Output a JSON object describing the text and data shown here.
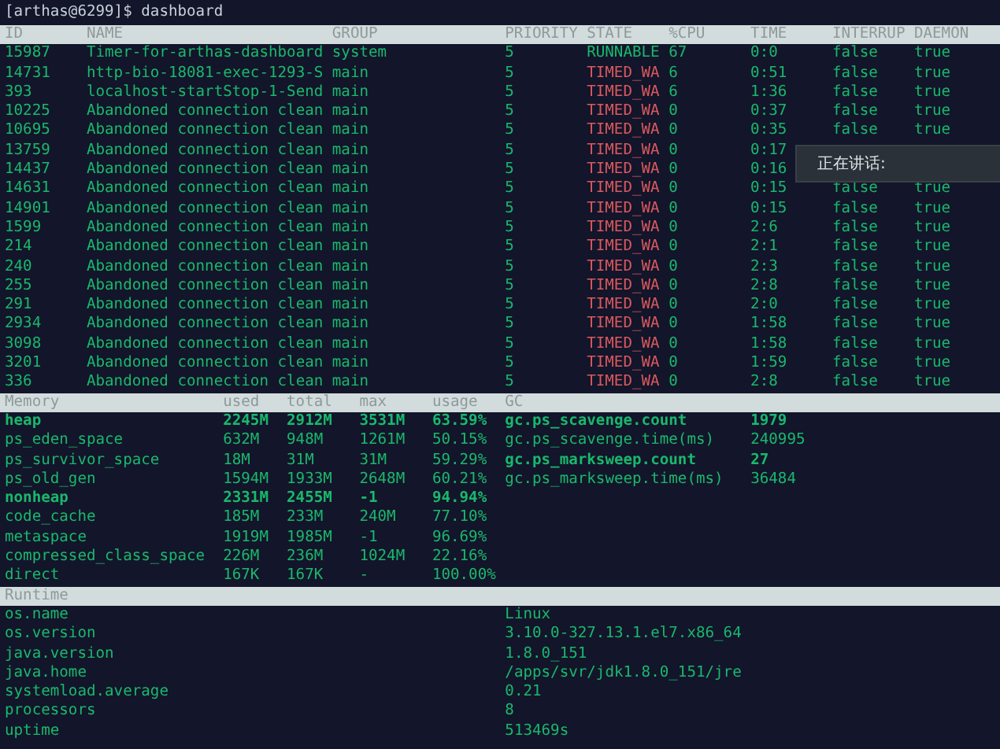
{
  "prompt": {
    "text": "[arthas@6299]$ dashboard"
  },
  "threads": {
    "columns": [
      "ID",
      "NAME",
      "GROUP",
      "PRIORITY",
      "STATE",
      "%CPU",
      "TIME",
      "INTERRUP",
      "DAEMON"
    ],
    "rows": [
      {
        "id": "15987",
        "name": "Timer-for-arthas-dashboard",
        "group": "system",
        "priority": "5",
        "state": "RUNNABLE",
        "color": "#19b86c",
        "cpu": "67",
        "time": "0:0",
        "interrupted": "false",
        "daemon": "true"
      },
      {
        "id": "14731",
        "name": "http-bio-18081-exec-1293-S",
        "group": "main",
        "priority": "5",
        "state": "TIMED_WA",
        "color": "#d9595f",
        "cpu": "6",
        "time": "0:51",
        "interrupted": "false",
        "daemon": "true"
      },
      {
        "id": "393",
        "name": "localhost-startStop-1-Send",
        "group": "main",
        "priority": "5",
        "state": "TIMED_WA",
        "color": "#d9595f",
        "cpu": "6",
        "time": "1:36",
        "interrupted": "false",
        "daemon": "true"
      },
      {
        "id": "10225",
        "name": "Abandoned connection clean",
        "group": "main",
        "priority": "5",
        "state": "TIMED_WA",
        "color": "#d9595f",
        "cpu": "0",
        "time": "0:37",
        "interrupted": "false",
        "daemon": "true"
      },
      {
        "id": "10695",
        "name": "Abandoned connection clean",
        "group": "main",
        "priority": "5",
        "state": "TIMED_WA",
        "color": "#d9595f",
        "cpu": "0",
        "time": "0:35",
        "interrupted": "false",
        "daemon": "true"
      },
      {
        "id": "13759",
        "name": "Abandoned connection clean",
        "group": "main",
        "priority": "5",
        "state": "TIMED_WA",
        "color": "#d9595f",
        "cpu": "0",
        "time": "0:17"
      },
      {
        "id": "14437",
        "name": "Abandoned connection clean",
        "group": "main",
        "priority": "5",
        "state": "TIMED_WA",
        "color": "#d9595f",
        "cpu": "0",
        "time": "0:16"
      },
      {
        "id": "14631",
        "name": "Abandoned connection clean",
        "group": "main",
        "priority": "5",
        "state": "TIMED_WA",
        "color": "#d9595f",
        "cpu": "0",
        "time": "0:15",
        "interrupted": "false",
        "daemon": "true"
      },
      {
        "id": "14901",
        "name": "Abandoned connection clean",
        "group": "main",
        "priority": "5",
        "state": "TIMED_WA",
        "color": "#d9595f",
        "cpu": "0",
        "time": "0:15",
        "interrupted": "false",
        "daemon": "true"
      },
      {
        "id": "1599",
        "name": "Abandoned connection clean",
        "group": "main",
        "priority": "5",
        "state": "TIMED_WA",
        "color": "#d9595f",
        "cpu": "0",
        "time": "2:6",
        "interrupted": "false",
        "daemon": "true"
      },
      {
        "id": "214",
        "name": "Abandoned connection clean",
        "group": "main",
        "priority": "5",
        "state": "TIMED_WA",
        "color": "#d9595f",
        "cpu": "0",
        "time": "2:1",
        "interrupted": "false",
        "daemon": "true"
      },
      {
        "id": "240",
        "name": "Abandoned connection clean",
        "group": "main",
        "priority": "5",
        "state": "TIMED_WA",
        "color": "#d9595f",
        "cpu": "0",
        "time": "2:3",
        "interrupted": "false",
        "daemon": "true"
      },
      {
        "id": "255",
        "name": "Abandoned connection clean",
        "group": "main",
        "priority": "5",
        "state": "TIMED_WA",
        "color": "#d9595f",
        "cpu": "0",
        "time": "2:8",
        "interrupted": "false",
        "daemon": "true"
      },
      {
        "id": "291",
        "name": "Abandoned connection clean",
        "group": "main",
        "priority": "5",
        "state": "TIMED_WA",
        "color": "#d9595f",
        "cpu": "0",
        "time": "2:0",
        "interrupted": "false",
        "daemon": "true"
      },
      {
        "id": "2934",
        "name": "Abandoned connection clean",
        "group": "main",
        "priority": "5",
        "state": "TIMED_WA",
        "color": "#d9595f",
        "cpu": "0",
        "time": "1:58",
        "interrupted": "false",
        "daemon": "true"
      },
      {
        "id": "3098",
        "name": "Abandoned connection clean",
        "group": "main",
        "priority": "5",
        "state": "TIMED_WA",
        "color": "#d9595f",
        "cpu": "0",
        "time": "1:58",
        "interrupted": "false",
        "daemon": "true"
      },
      {
        "id": "3201",
        "name": "Abandoned connection clean",
        "group": "main",
        "priority": "5",
        "state": "TIMED_WA",
        "color": "#d9595f",
        "cpu": "0",
        "time": "1:59",
        "interrupted": "false",
        "daemon": "true"
      },
      {
        "id": "336",
        "name": "Abandoned connection clean",
        "group": "main",
        "priority": "5",
        "state": "TIMED_WA",
        "color": "#d9595f",
        "cpu": "0",
        "time": "2:8",
        "interrupted": "false",
        "daemon": "true"
      }
    ]
  },
  "memory": {
    "columns": [
      "Memory",
      "used",
      "total",
      "max",
      "usage"
    ],
    "rows": [
      {
        "name": "heap",
        "used": "2245M",
        "total": "2912M",
        "max": "3531M",
        "usage": "63.59%",
        "bold": true
      },
      {
        "name": "ps_eden_space",
        "used": "632M",
        "total": "948M",
        "max": "1261M",
        "usage": "50.15%",
        "bold": false
      },
      {
        "name": "ps_survivor_space",
        "used": "18M",
        "total": "31M",
        "max": "31M",
        "usage": "59.29%",
        "bold": false
      },
      {
        "name": "ps_old_gen",
        "used": "1594M",
        "total": "1933M",
        "max": "2648M",
        "usage": "60.21%",
        "bold": false
      },
      {
        "name": "nonheap",
        "used": "2331M",
        "total": "2455M",
        "max": "-1",
        "usage": "94.94%",
        "bold": true
      },
      {
        "name": "code_cache",
        "used": "185M",
        "total": "233M",
        "max": "240M",
        "usage": "77.10%",
        "bold": false
      },
      {
        "name": "metaspace",
        "used": "1919M",
        "total": "1985M",
        "max": "-1",
        "usage": "96.69%",
        "bold": false
      },
      {
        "name": "compressed_class_space",
        "used": "226M",
        "total": "236M",
        "max": "1024M",
        "usage": "22.16%",
        "bold": false
      },
      {
        "name": "direct",
        "used": "167K",
        "total": "167K",
        "max": "-",
        "usage": "100.00%",
        "bold": false
      }
    ]
  },
  "gc": {
    "columns": [
      "GC"
    ],
    "rows": [
      {
        "name": "gc.ps_scavenge.count",
        "value": "1979",
        "bold": true
      },
      {
        "name": "gc.ps_scavenge.time(ms)",
        "value": "240995",
        "bold": false
      },
      {
        "name": "gc.ps_marksweep.count",
        "value": "27",
        "bold": true
      },
      {
        "name": "gc.ps_marksweep.time(ms)",
        "value": "36484",
        "bold": false
      }
    ]
  },
  "runtime": {
    "columns": [
      "Runtime"
    ],
    "rows": [
      {
        "name": "os.name",
        "value": "Linux"
      },
      {
        "name": "os.version",
        "value": "3.10.0-327.13.1.el7.x86_64"
      },
      {
        "name": "java.version",
        "value": "1.8.0_151"
      },
      {
        "name": "java.home",
        "value": "/apps/svr/jdk1.8.0_151/jre"
      },
      {
        "name": "systemload.average",
        "value": "0.21"
      },
      {
        "name": "processors",
        "value": "8"
      },
      {
        "name": "uptime",
        "value": "513469s"
      }
    ]
  },
  "popup": {
    "text": "正在讲话:"
  }
}
